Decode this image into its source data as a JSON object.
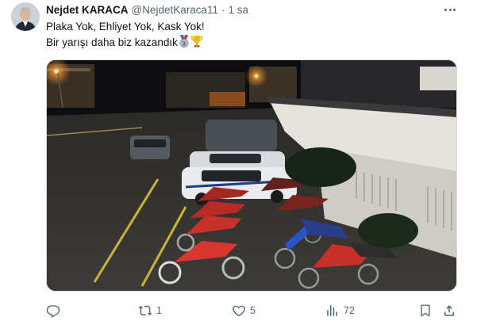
{
  "tweet": {
    "display_name": "Nejdet KARACA",
    "handle": "@NejdetKaraca11",
    "separator": "·",
    "time": "1 sa",
    "text_line1": "Plaka Yok, Ehliyet Yok, Kask Yok!",
    "text_line2": "Bir yarışı daha biz kazandık",
    "emojis": [
      "2nd-place-medal-icon",
      "trophy-icon"
    ]
  },
  "actions": {
    "reply": {
      "icon": "reply-icon",
      "count": ""
    },
    "retweet": {
      "icon": "retweet-icon",
      "count": "1"
    },
    "like": {
      "icon": "heart-icon",
      "count": "5"
    },
    "views": {
      "icon": "views-chart-icon",
      "count": "72"
    },
    "bookmark": {
      "icon": "bookmark-icon",
      "count": ""
    },
    "share": {
      "icon": "share-icon",
      "count": ""
    }
  },
  "colors": {
    "text_primary": "#0f1419",
    "text_secondary": "#536471",
    "border": "#cfd9de"
  }
}
